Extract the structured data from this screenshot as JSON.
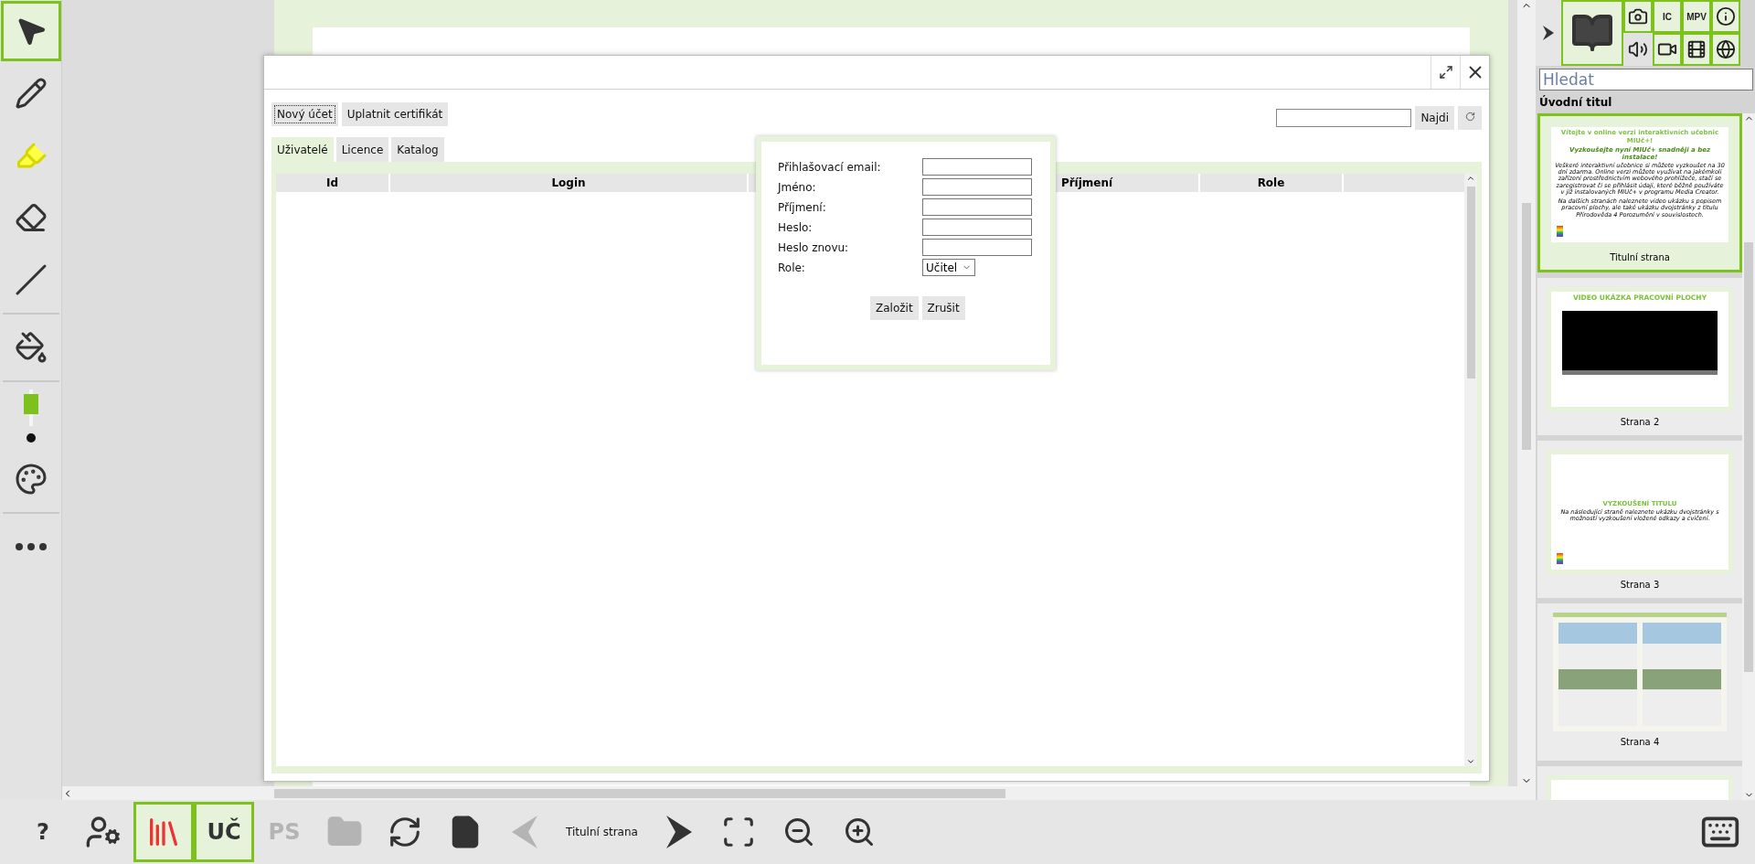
{
  "tools": [
    {
      "kind": "pointer",
      "selected": true
    },
    {
      "kind": "pencil",
      "selected": false
    },
    {
      "kind": "highlighter",
      "selected": false
    },
    {
      "kind": "eraser",
      "selected": false
    },
    {
      "kind": "line",
      "selected": false
    },
    {
      "kind": "fill",
      "selected": false
    }
  ],
  "size_slider": {
    "level": 0.75
  },
  "extra_tools": [
    {
      "kind": "palette"
    },
    {
      "kind": "more"
    }
  ],
  "dialog": {
    "buttons": [
      "Nový účet",
      "Uplatnit certifikát"
    ],
    "tabs": [
      {
        "label": "Uživatelé",
        "selected": true
      },
      {
        "label": "Licence",
        "selected": false
      },
      {
        "label": "Katalog",
        "selected": false
      }
    ],
    "search": {
      "button": "Najdi"
    },
    "table": {
      "columns": [
        "Id",
        "Login",
        "Příjmení",
        "Role"
      ]
    },
    "form": {
      "fields": [
        {
          "label": "Přihlašovací email:"
        },
        {
          "label": "Jméno:"
        },
        {
          "label": "Příjmení:"
        },
        {
          "label": "Heslo:"
        },
        {
          "label": "Heslo znovu:"
        }
      ],
      "role": {
        "label": "Role:",
        "value": "Učitel"
      },
      "buttons": [
        "Založit",
        "Zrušit"
      ]
    }
  },
  "media_buttons": [
    {
      "kind": "book",
      "selected": true
    },
    {
      "kind": "camera",
      "selected": true
    },
    {
      "kind": "text",
      "label": "IC",
      "selected": true
    },
    {
      "kind": "text",
      "label": "MPV",
      "selected": true
    },
    {
      "kind": "info",
      "selected": true
    },
    {
      "kind": "speaker",
      "selected": false
    },
    {
      "kind": "video",
      "selected": true
    },
    {
      "kind": "film",
      "selected": true
    },
    {
      "kind": "globe",
      "selected": true
    }
  ],
  "side_search": {
    "placeholder": "Hledat"
  },
  "section_title": "Úvodní titul",
  "thumbnails": [
    {
      "kind": "intro",
      "selected": true,
      "title": "Vítejte v online verzi interaktivních učebnic MIUč+!",
      "subtitle": "Vyzkoušejte nyní MIUč+ snadněji a bez instalace!",
      "paragraphs": [
        "Veškeré interaktivní učebnice si můžete vyzkoušet na 30 dní zdarma. Online verzi můžete využívat na jakémkoli zařízení prostřednictvím webového prohlížeče, stačí se zaregistrovat či se přihlásit údaji, které běžně používáte v již instalovaných MIUč+ v programu Media Creator.",
        "Na dalších stranách naleznete video ukázku s popisem pracovní plochy, ale také ukázku dvojstránky z titulu Přírodověda 4 Porozumění v souvislostech."
      ],
      "caption": "Titulní strana"
    },
    {
      "kind": "video",
      "selected": false,
      "title": "VIDEO UKÁZKA PRACOVNÍ PLOCHY",
      "caption": "Strana 2"
    },
    {
      "kind": "text",
      "selected": false,
      "title": "VYZKOUŠENÍ TITULU",
      "paragraphs": [
        "Na následující straně naleznete ukázku dvojstránky s možností vyzkoušení vložené odkazy a cvičení."
      ],
      "caption": "Strana 3"
    },
    {
      "kind": "spread",
      "selected": false,
      "caption": "Strana 4"
    },
    {
      "kind": "blank",
      "selected": false
    }
  ],
  "bottom_items": [
    {
      "kind": "text",
      "label": "?",
      "selected": false,
      "disabled": false
    },
    {
      "kind": "user-settings",
      "selected": false,
      "disabled": false
    },
    {
      "kind": "books",
      "selected": true,
      "disabled": false
    },
    {
      "kind": "text",
      "label": "UČ",
      "selected": true,
      "disabled": false
    },
    {
      "kind": "text",
      "label": "PS",
      "selected": false,
      "disabled": true
    },
    {
      "kind": "folder",
      "selected": false,
      "disabled": true
    },
    {
      "kind": "sync",
      "selected": false,
      "disabled": false
    },
    {
      "kind": "document",
      "selected": false,
      "disabled": false
    },
    {
      "kind": "prev",
      "selected": false,
      "disabled": true
    },
    {
      "kind": "page",
      "label": "Titulní strana",
      "selected": false
    },
    {
      "kind": "next",
      "selected": false,
      "disabled": false
    },
    {
      "kind": "fullscreen",
      "selected": false,
      "disabled": false
    },
    {
      "kind": "zoom-out",
      "selected": false,
      "disabled": false
    },
    {
      "kind": "zoom-in",
      "selected": false,
      "disabled": false
    }
  ]
}
